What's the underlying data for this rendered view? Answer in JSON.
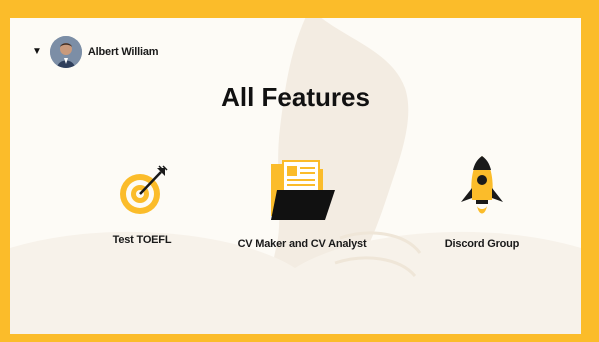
{
  "user": {
    "name": "Albert William",
    "caret_icon": "caret-down-icon"
  },
  "page": {
    "title": "All Features"
  },
  "features": [
    {
      "label": "Test TOEFL",
      "icon": "target-icon"
    },
    {
      "label": "CV Maker and CV Analyst",
      "icon": "folder-document-icon"
    },
    {
      "label": "Discord Group",
      "icon": "rocket-icon"
    }
  ],
  "colors": {
    "accent": "#fbbc2a",
    "background": "#fdfbf6",
    "text": "#111111"
  }
}
